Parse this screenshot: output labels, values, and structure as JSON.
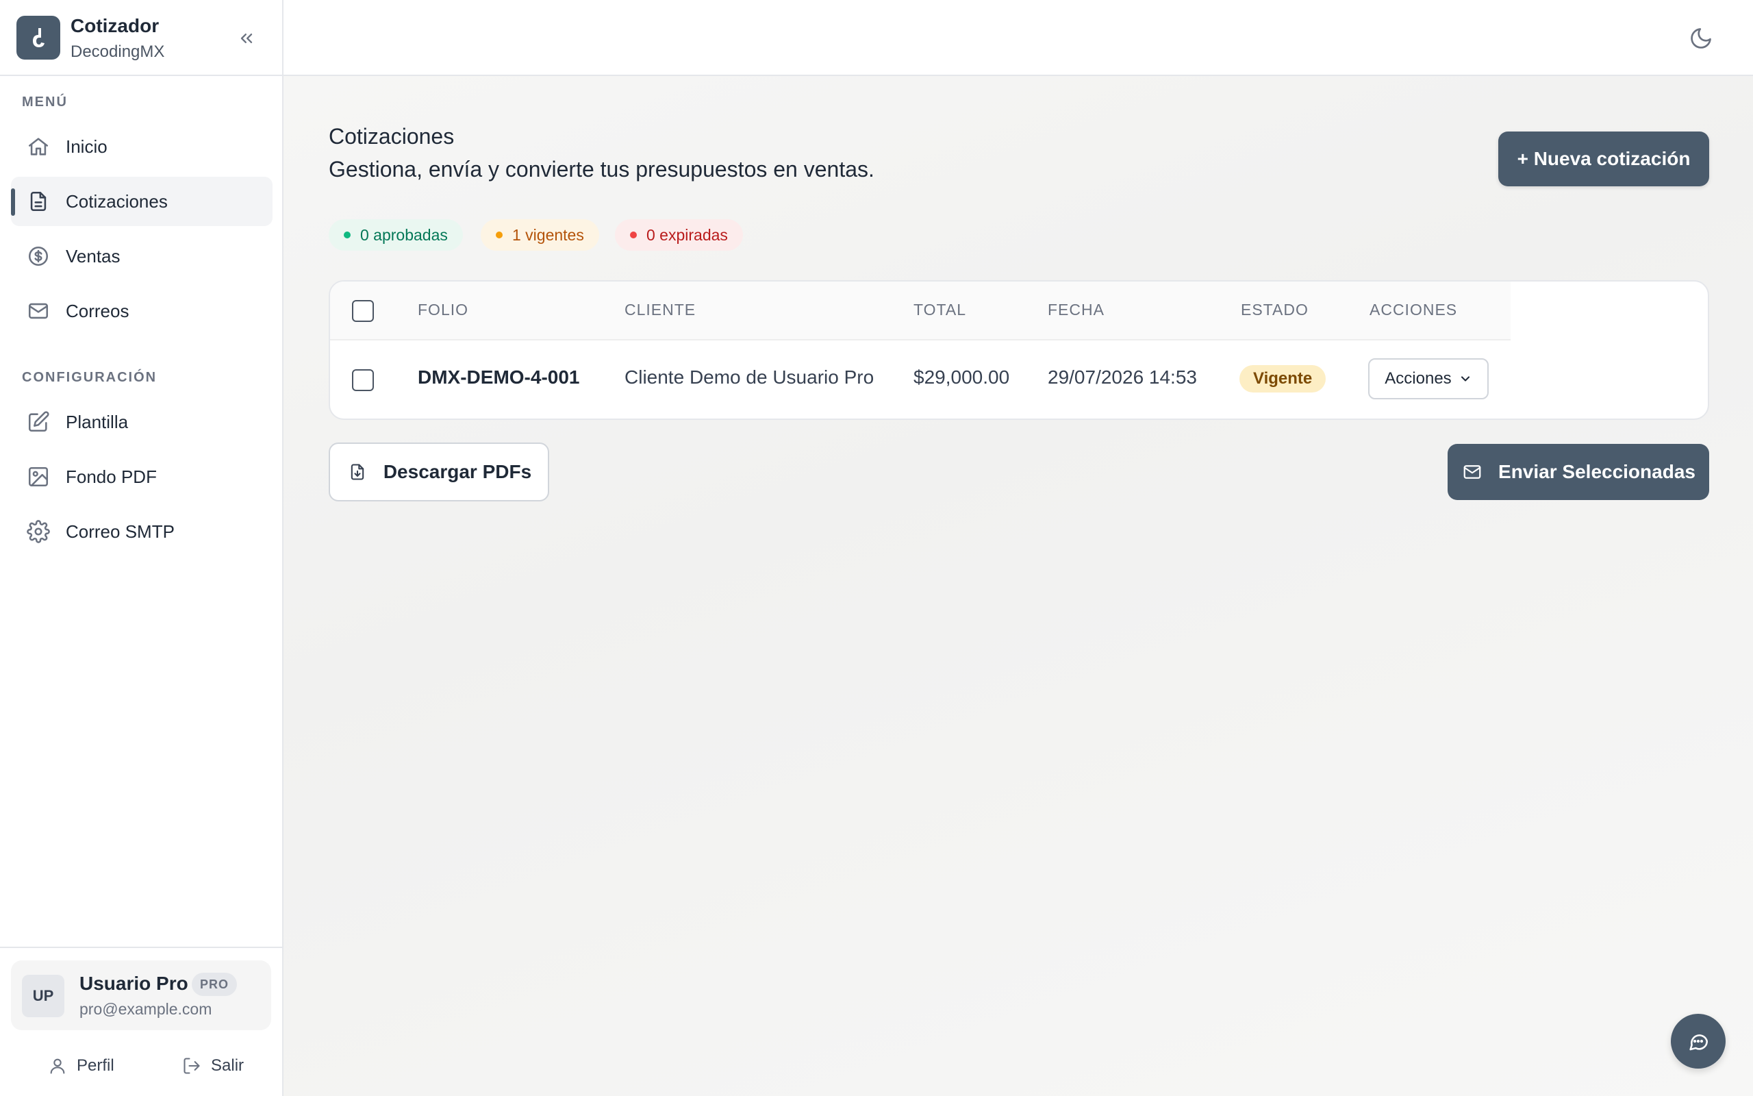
{
  "app": {
    "title": "Cotizador",
    "subtitle": "DecodingMX"
  },
  "sidebar": {
    "menu_label": "MENÚ",
    "menu_items": [
      {
        "label": "Inicio",
        "icon": "home-icon"
      },
      {
        "label": "Cotizaciones",
        "icon": "document-icon",
        "active": true
      },
      {
        "label": "Ventas",
        "icon": "dollar-icon"
      },
      {
        "label": "Correos",
        "icon": "mail-icon"
      }
    ],
    "config_label": "CONFIGURACIÓN",
    "config_items": [
      {
        "label": "Plantilla",
        "icon": "edit-icon"
      },
      {
        "label": "Fondo PDF",
        "icon": "image-icon"
      },
      {
        "label": "Correo SMTP",
        "icon": "gear-icon"
      }
    ],
    "user": {
      "initials": "UP",
      "name": "Usuario Pro",
      "badge": "PRO",
      "email": "pro@example.com"
    },
    "footer": {
      "profile_label": "Perfil",
      "logout_label": "Salir"
    }
  },
  "page": {
    "title": "Cotizaciones",
    "subtitle": "Gestiona, envía y convierte tus presupuestos en ventas.",
    "new_button": "+ Nueva cotización",
    "stats": [
      {
        "label": "0 aprobadas",
        "color": "#10b981"
      },
      {
        "label": "1 vigentes",
        "color": "#f59e0b"
      },
      {
        "label": "0 expiradas",
        "color": "#ef4444"
      }
    ]
  },
  "table": {
    "columns": [
      "FOLIO",
      "CLIENTE",
      "TOTAL",
      "FECHA",
      "ESTADO",
      "ACCIONES"
    ],
    "rows": [
      {
        "folio": "DMX-DEMO-4-001",
        "cliente": "Cliente Demo de Usuario Pro",
        "total": "$29,000.00",
        "fecha": "29/07/2026 14:53",
        "estado": "Vigente",
        "acciones": "Acciones"
      }
    ]
  },
  "actions": {
    "download_label": "Descargar PDFs",
    "send_label": "Enviar Seleccionadas"
  },
  "colors": {
    "primary": "#4a5b6c",
    "status_vigente_bg": "#fdeec4"
  }
}
